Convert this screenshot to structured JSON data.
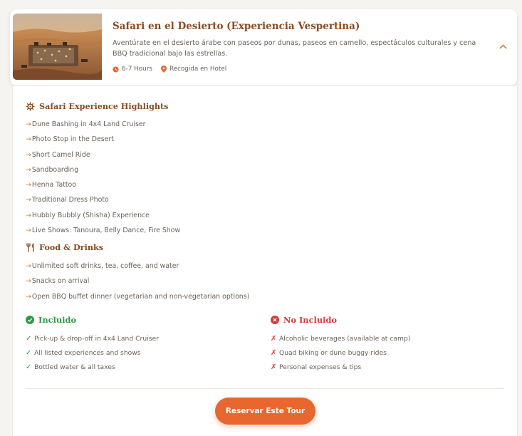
{
  "tour": {
    "title": "Safari en el Desierto (Experiencia Vespertina)",
    "description": "Aventúrate en el desierto árabe con paseos por dunas, paseos en camello, espectáculos culturales y cena BBQ tradicional bajo las estrellas.",
    "duration": "6-7 Hours",
    "pickup": "Recogida en Hotel"
  },
  "highlights": {
    "title": "Safari Experience Highlights",
    "items": [
      "Dune Bashing in 4x4 Land Cruiser",
      "Photo Stop in the Desert",
      "Short Camel Ride",
      "Sandboarding",
      "Henna Tattoo",
      "Traditional Dress Photo",
      "Hubbly Bubbly (Shisha) Experience",
      "Live Shows: Tanoura, Belly Dance, Fire Show"
    ]
  },
  "food": {
    "title": "Food & Drinks",
    "items": [
      "Unlimited soft drinks, tea, coffee, and water",
      "Snacks on arrival",
      "Open BBQ buffet dinner (vegetarian and non-vegetarian options)"
    ]
  },
  "included": {
    "title": "Incluido",
    "items": [
      "Pick-up & drop-off in 4x4 Land Cruiser",
      "All listed experiences and shows",
      "Bottled water & all taxes"
    ]
  },
  "not_included": {
    "title": "No Incluido",
    "items": [
      "Alcoholic beverages (available at camp)",
      "Quad biking or dune buggy rides",
      "Personal expenses & tips"
    ]
  },
  "cta_label": "Reservar Este Tour",
  "colors": {
    "title_brown": "#8a4b1f",
    "accent_orange": "#e8662f",
    "arrow_orange": "#c9782a",
    "included_green": "#2e9a45",
    "not_included_red": "#d6393f"
  },
  "icons": {
    "duration": "clock-icon",
    "pickup": "location-pin-icon",
    "collapse": "chevron-up-icon",
    "highlights": "ship-wheel-icon",
    "food": "fork-knife-icon",
    "included": "check-circle-icon",
    "not_included": "x-circle-icon"
  }
}
